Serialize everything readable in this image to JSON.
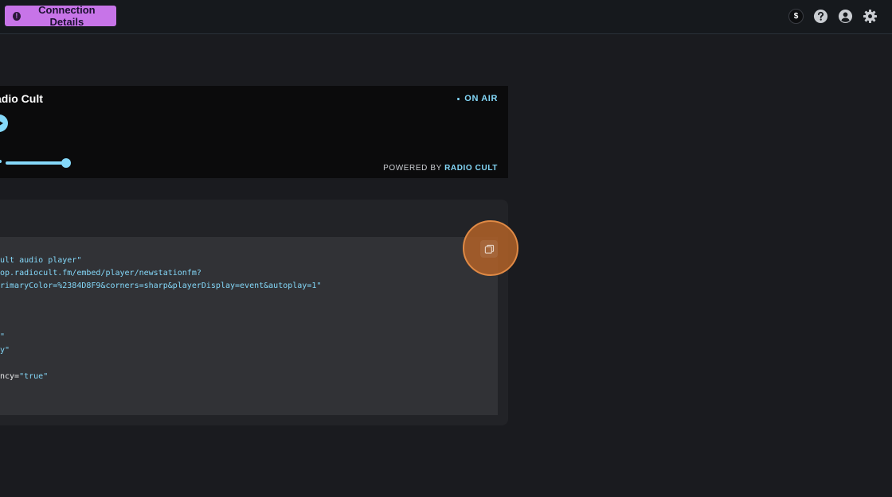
{
  "topbar": {
    "connection_button_label": "Connection Details",
    "icons": [
      "info-icon",
      "dollar-icon",
      "help-icon",
      "account-icon",
      "settings-icon"
    ],
    "dollar_symbol": "$",
    "info_symbol": "!"
  },
  "player": {
    "title": "adio Cult",
    "on_air": "ON AIR",
    "powered_prefix": "POWERED BY ",
    "powered_brand": "RADIO CULT",
    "volume": 0.85,
    "accent_color": "#84D8F9"
  },
  "code": {
    "lines": [
      {
        "plain": "",
        "str": "ult audio player\""
      },
      {
        "plain": "",
        "str": "op.radiocult.fm/embed/player/newstationfm?"
      },
      {
        "plain": "",
        "str": "rimaryColor=%2384D8F9&corners=sharp&playerDisplay=event&autoplay=1\""
      },
      {
        "plain": "",
        "str": "\""
      },
      {
        "plain": "",
        "str": "y\""
      },
      {
        "plain": "ncy=",
        "str": "\"true\""
      }
    ]
  },
  "colors": {
    "background": "#1a1b1f",
    "topbar": "#16191d",
    "connection_button": "#c774e8",
    "highlight": "#e08a45"
  }
}
